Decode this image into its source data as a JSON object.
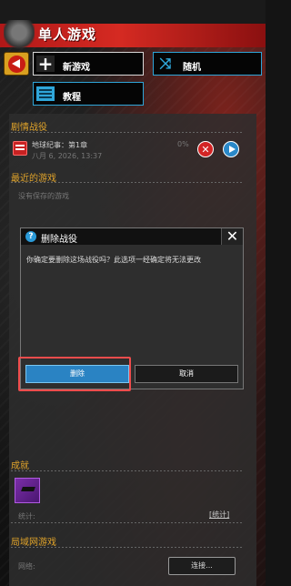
{
  "header": {
    "title": "单人游戏"
  },
  "nav": {
    "back_icon": "back-arrow-icon",
    "new_game": "新游戏",
    "random": "随机",
    "tutorial": "教程"
  },
  "campaign": {
    "section_title": "剧情战役",
    "entry_name": "地球纪事：第1章",
    "entry_date": "八月 6, 2026, 13:37",
    "progress": "0%"
  },
  "recent": {
    "section_title": "最近的游戏",
    "empty_text": "没有保存的游戏"
  },
  "dialog": {
    "title": "删除战役",
    "message": "你确定要删除这场战役吗？此选项一经确定将无法更改",
    "close_glyph": "✕",
    "delete_label": "删除",
    "cancel_label": "取消"
  },
  "achievements": {
    "section_title": "成就",
    "stats_label": "统计:",
    "stats_link": "[统计]"
  },
  "lan": {
    "section_title": "局域网游戏",
    "network_label": "网络:",
    "connect_label": "连接..."
  },
  "colors": {
    "accent_orange": "#e0a32a",
    "header_red": "#d52a22",
    "button_blue": "#2a83c3",
    "highlight_red": "#ef4c4c"
  }
}
